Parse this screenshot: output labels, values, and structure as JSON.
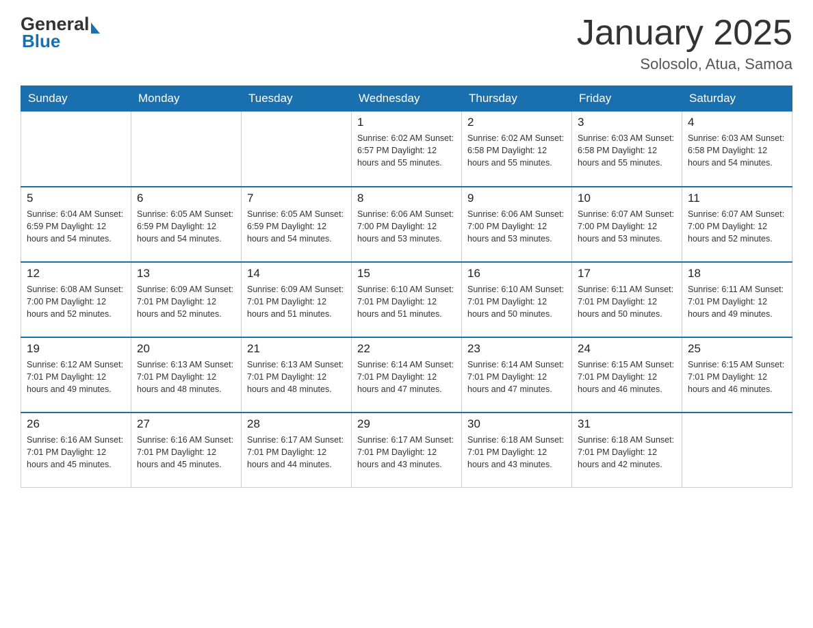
{
  "header": {
    "logo": {
      "general": "General",
      "blue": "Blue",
      "arrow": "▶"
    },
    "title": "January 2025",
    "location": "Solosolo, Atua, Samoa"
  },
  "calendar": {
    "days_of_week": [
      "Sunday",
      "Monday",
      "Tuesday",
      "Wednesday",
      "Thursday",
      "Friday",
      "Saturday"
    ],
    "weeks": [
      [
        {
          "day": "",
          "info": ""
        },
        {
          "day": "",
          "info": ""
        },
        {
          "day": "",
          "info": ""
        },
        {
          "day": "1",
          "info": "Sunrise: 6:02 AM\nSunset: 6:57 PM\nDaylight: 12 hours\nand 55 minutes."
        },
        {
          "day": "2",
          "info": "Sunrise: 6:02 AM\nSunset: 6:58 PM\nDaylight: 12 hours\nand 55 minutes."
        },
        {
          "day": "3",
          "info": "Sunrise: 6:03 AM\nSunset: 6:58 PM\nDaylight: 12 hours\nand 55 minutes."
        },
        {
          "day": "4",
          "info": "Sunrise: 6:03 AM\nSunset: 6:58 PM\nDaylight: 12 hours\nand 54 minutes."
        }
      ],
      [
        {
          "day": "5",
          "info": "Sunrise: 6:04 AM\nSunset: 6:59 PM\nDaylight: 12 hours\nand 54 minutes."
        },
        {
          "day": "6",
          "info": "Sunrise: 6:05 AM\nSunset: 6:59 PM\nDaylight: 12 hours\nand 54 minutes."
        },
        {
          "day": "7",
          "info": "Sunrise: 6:05 AM\nSunset: 6:59 PM\nDaylight: 12 hours\nand 54 minutes."
        },
        {
          "day": "8",
          "info": "Sunrise: 6:06 AM\nSunset: 7:00 PM\nDaylight: 12 hours\nand 53 minutes."
        },
        {
          "day": "9",
          "info": "Sunrise: 6:06 AM\nSunset: 7:00 PM\nDaylight: 12 hours\nand 53 minutes."
        },
        {
          "day": "10",
          "info": "Sunrise: 6:07 AM\nSunset: 7:00 PM\nDaylight: 12 hours\nand 53 minutes."
        },
        {
          "day": "11",
          "info": "Sunrise: 6:07 AM\nSunset: 7:00 PM\nDaylight: 12 hours\nand 52 minutes."
        }
      ],
      [
        {
          "day": "12",
          "info": "Sunrise: 6:08 AM\nSunset: 7:00 PM\nDaylight: 12 hours\nand 52 minutes."
        },
        {
          "day": "13",
          "info": "Sunrise: 6:09 AM\nSunset: 7:01 PM\nDaylight: 12 hours\nand 52 minutes."
        },
        {
          "day": "14",
          "info": "Sunrise: 6:09 AM\nSunset: 7:01 PM\nDaylight: 12 hours\nand 51 minutes."
        },
        {
          "day": "15",
          "info": "Sunrise: 6:10 AM\nSunset: 7:01 PM\nDaylight: 12 hours\nand 51 minutes."
        },
        {
          "day": "16",
          "info": "Sunrise: 6:10 AM\nSunset: 7:01 PM\nDaylight: 12 hours\nand 50 minutes."
        },
        {
          "day": "17",
          "info": "Sunrise: 6:11 AM\nSunset: 7:01 PM\nDaylight: 12 hours\nand 50 minutes."
        },
        {
          "day": "18",
          "info": "Sunrise: 6:11 AM\nSunset: 7:01 PM\nDaylight: 12 hours\nand 49 minutes."
        }
      ],
      [
        {
          "day": "19",
          "info": "Sunrise: 6:12 AM\nSunset: 7:01 PM\nDaylight: 12 hours\nand 49 minutes."
        },
        {
          "day": "20",
          "info": "Sunrise: 6:13 AM\nSunset: 7:01 PM\nDaylight: 12 hours\nand 48 minutes."
        },
        {
          "day": "21",
          "info": "Sunrise: 6:13 AM\nSunset: 7:01 PM\nDaylight: 12 hours\nand 48 minutes."
        },
        {
          "day": "22",
          "info": "Sunrise: 6:14 AM\nSunset: 7:01 PM\nDaylight: 12 hours\nand 47 minutes."
        },
        {
          "day": "23",
          "info": "Sunrise: 6:14 AM\nSunset: 7:01 PM\nDaylight: 12 hours\nand 47 minutes."
        },
        {
          "day": "24",
          "info": "Sunrise: 6:15 AM\nSunset: 7:01 PM\nDaylight: 12 hours\nand 46 minutes."
        },
        {
          "day": "25",
          "info": "Sunrise: 6:15 AM\nSunset: 7:01 PM\nDaylight: 12 hours\nand 46 minutes."
        }
      ],
      [
        {
          "day": "26",
          "info": "Sunrise: 6:16 AM\nSunset: 7:01 PM\nDaylight: 12 hours\nand 45 minutes."
        },
        {
          "day": "27",
          "info": "Sunrise: 6:16 AM\nSunset: 7:01 PM\nDaylight: 12 hours\nand 45 minutes."
        },
        {
          "day": "28",
          "info": "Sunrise: 6:17 AM\nSunset: 7:01 PM\nDaylight: 12 hours\nand 44 minutes."
        },
        {
          "day": "29",
          "info": "Sunrise: 6:17 AM\nSunset: 7:01 PM\nDaylight: 12 hours\nand 43 minutes."
        },
        {
          "day": "30",
          "info": "Sunrise: 6:18 AM\nSunset: 7:01 PM\nDaylight: 12 hours\nand 43 minutes."
        },
        {
          "day": "31",
          "info": "Sunrise: 6:18 AM\nSunset: 7:01 PM\nDaylight: 12 hours\nand 42 minutes."
        },
        {
          "day": "",
          "info": ""
        }
      ]
    ]
  }
}
